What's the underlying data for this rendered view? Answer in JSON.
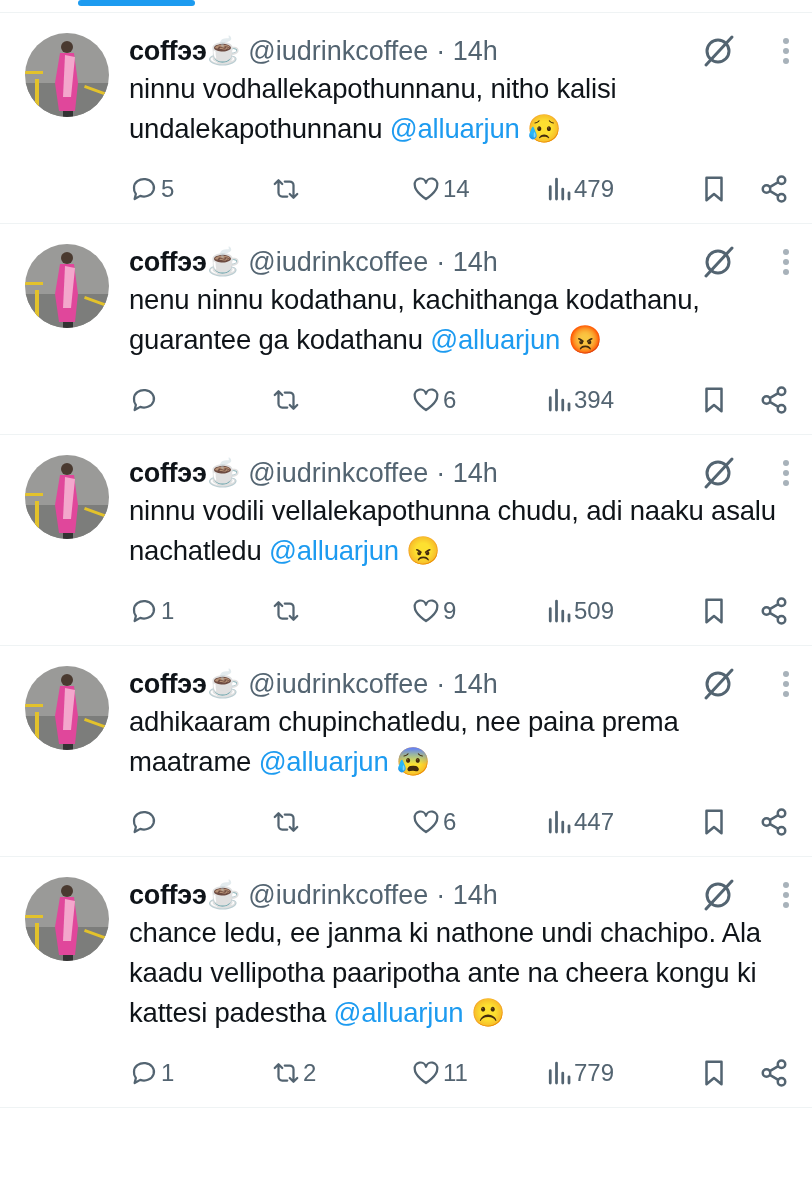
{
  "tab_indicator": {
    "selected": true
  },
  "tweets": [
    {
      "name": "coffээ☕",
      "handle": "@iudrinkcoffee",
      "time": "· 14h",
      "text": "ninnu vodhallekapothunnanu, nitho kalisi undalekapothunnanu",
      "mention": "@alluarjun",
      "emoji": "😥",
      "replies": "5",
      "likes": "14",
      "views": "479"
    },
    {
      "name": "coffээ☕",
      "handle": "@iudrinkcoffee",
      "time": "· 14h",
      "text": "nenu ninnu kodathanu, kachithanga kodathanu, guarantee ga kodathanu",
      "mention": "@alluarjun",
      "emoji": "😡",
      "likes": "6",
      "views": "394"
    },
    {
      "name": "coffээ☕",
      "handle": "@iudrinkcoffee",
      "time": "· 14h",
      "text": "ninnu vodili vellalekapothunna chudu, adi naaku asalu nachatledu",
      "mention": "@alluarjun",
      "emoji": "😠",
      "replies": "1",
      "likes": "9",
      "views": "509"
    },
    {
      "name": "coffээ☕",
      "handle": "@iudrinkcoffee",
      "time": "· 14h",
      "text": "adhikaaram chupinchatledu, nee paina prema maatrame",
      "mention": "@alluarjun",
      "emoji": "😰",
      "likes": "6",
      "views": "447"
    },
    {
      "name": "coffээ☕",
      "handle": "@iudrinkcoffee",
      "time": "· 14h",
      "text": "chance ledu, ee janma ki nathone undi chachipo. Ala kaadu vellipotha paaripotha ante na cheera kongu ki kattesi padestha",
      "mention": "@alluarjun",
      "emoji": "☹️",
      "replies": "1",
      "retweets": "2",
      "likes": "11",
      "views": "779"
    }
  ]
}
